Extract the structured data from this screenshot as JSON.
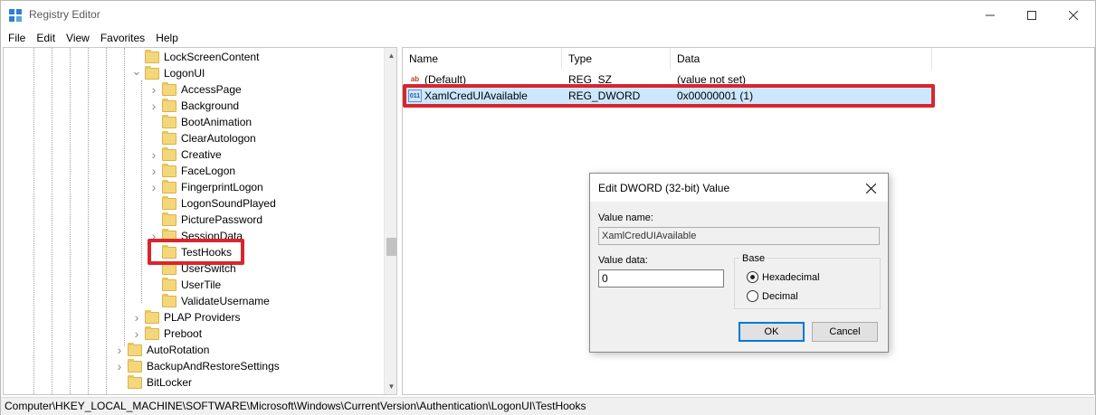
{
  "window": {
    "title": "Registry Editor"
  },
  "menu": [
    "File",
    "Edit",
    "View",
    "Favorites",
    "Help"
  ],
  "tree": [
    {
      "label": "LockScreenContent",
      "level": 2,
      "expander": ""
    },
    {
      "label": "LogonUI",
      "level": 2,
      "expander": "expanded"
    },
    {
      "label": "AccessPage",
      "level": 3,
      "expander": "collapsed"
    },
    {
      "label": "Background",
      "level": 3,
      "expander": "collapsed"
    },
    {
      "label": "BootAnimation",
      "level": 3,
      "expander": ""
    },
    {
      "label": "ClearAutologon",
      "level": 3,
      "expander": ""
    },
    {
      "label": "Creative",
      "level": 3,
      "expander": "collapsed"
    },
    {
      "label": "FaceLogon",
      "level": 3,
      "expander": "collapsed"
    },
    {
      "label": "FingerprintLogon",
      "level": 3,
      "expander": "collapsed"
    },
    {
      "label": "LogonSoundPlayed",
      "level": 3,
      "expander": ""
    },
    {
      "label": "PicturePassword",
      "level": 3,
      "expander": ""
    },
    {
      "label": "SessionData",
      "level": 3,
      "expander": "collapsed"
    },
    {
      "label": "TestHooks",
      "level": 3,
      "expander": ""
    },
    {
      "label": "UserSwitch",
      "level": 3,
      "expander": ""
    },
    {
      "label": "UserTile",
      "level": 3,
      "expander": ""
    },
    {
      "label": "ValidateUsername",
      "level": 3,
      "expander": ""
    },
    {
      "label": "PLAP Providers",
      "level": 2,
      "expander": "collapsed"
    },
    {
      "label": "Preboot",
      "level": 2,
      "expander": "collapsed"
    },
    {
      "label": "AutoRotation",
      "level": 1,
      "expander": "collapsed"
    },
    {
      "label": "BackupAndRestoreSettings",
      "level": 1,
      "expander": "collapsed"
    },
    {
      "label": "BitLocker",
      "level": 1,
      "expander": ""
    }
  ],
  "list": {
    "columns": [
      "Name",
      "Type",
      "Data"
    ],
    "rows": [
      {
        "icon": "ab",
        "name": "(Default)",
        "type": "REG_SZ",
        "data": "(value not set)"
      },
      {
        "icon": "011",
        "name": "XamlCredUIAvailable",
        "type": "REG_DWORD",
        "data": "0x00000001 (1)"
      }
    ]
  },
  "statusbar": {
    "path": "Computer\\HKEY_LOCAL_MACHINE\\SOFTWARE\\Microsoft\\Windows\\CurrentVersion\\Authentication\\LogonUI\\TestHooks"
  },
  "dialog": {
    "title": "Edit DWORD (32-bit) Value",
    "value_name_label": "Value name:",
    "value_name": "XamlCredUIAvailable",
    "value_data_label": "Value data:",
    "value_data": "0",
    "base_label": "Base",
    "hex_label": "Hexadecimal",
    "dec_label": "Decimal",
    "ok_label": "OK",
    "cancel_label": "Cancel"
  },
  "colors": {
    "highlight_red": "#d8262e",
    "selection": "#cce8ff",
    "accent": "#0078d7"
  }
}
